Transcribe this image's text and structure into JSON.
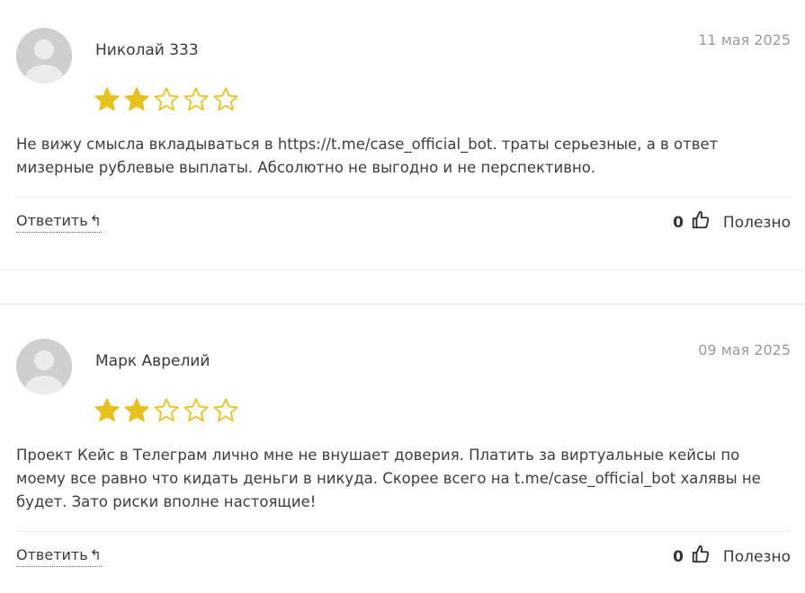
{
  "reviews": [
    {
      "author": "Николай 333",
      "date": "11 мая 2025",
      "rating": 2,
      "max_rating": 5,
      "text": "Не вижу смысла вкладываться в https://t.me/case_official_bot. траты серьезные, а в ответ мизерные рублевые выплаты. Абсолютно не выгодно и не перспективно.",
      "reply_label": "Ответить",
      "reply_icon": "reply-arrow-icon",
      "helpful_count": "0",
      "helpful_label": "Полезно"
    },
    {
      "author": "Марк Аврелий",
      "date": "09 мая 2025",
      "rating": 2,
      "max_rating": 5,
      "text": "Проект Кейс в Телеграм лично мне не внушает доверия. Платить за виртуальные кейсы по моему все равно что кидать деньги в никуда. Скорее всего на t.me/case_official_bot халявы не будет. Зато риски вполне настоящие!",
      "reply_label": "Ответить",
      "reply_icon": "reply-arrow-icon",
      "helpful_count": "0",
      "helpful_label": "Полезно"
    }
  ],
  "colors": {
    "star": "#e8c21c",
    "avatar_bg": "#cfcfcf",
    "date": "#9a9a9a"
  }
}
